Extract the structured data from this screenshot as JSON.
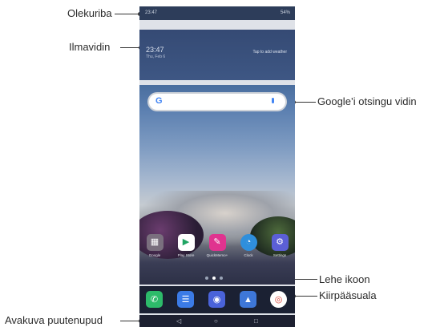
{
  "callouts": {
    "status_bar": "Olekuriba",
    "weather_widget": "Ilmavidin",
    "google_search": "Google’i otsingu vidin",
    "page_icon": "Lehe ikoon",
    "quick_access": "Kiirpääsuala",
    "home_touch_buttons": "Avakuva puutenupud"
  },
  "status_bar": {
    "time": "23:47",
    "battery": "54%"
  },
  "weather": {
    "clock": "23:47",
    "date": "Thu, Feb 6",
    "hint": "Tap to add weather"
  },
  "google": {
    "logo": "G"
  },
  "apps": [
    {
      "name": "Google",
      "icon": "google-folder-icon",
      "color": "#7a6f7e"
    },
    {
      "name": "Play Store",
      "icon": "play-store-icon",
      "color": "#ffffff"
    },
    {
      "name": "QuickMemo+",
      "icon": "quickmemo-icon",
      "color": "#e0338f"
    },
    {
      "name": "Clock",
      "icon": "clock-icon",
      "color": "#2f8fdc"
    },
    {
      "name": "Settings",
      "icon": "settings-icon",
      "color": "#5b5fd6"
    }
  ],
  "dock": [
    {
      "icon": "phone-icon",
      "color": "#2dbb6a"
    },
    {
      "icon": "messages-icon",
      "color": "#3b7be6"
    },
    {
      "icon": "camera-icon",
      "color": "#4a63d9"
    },
    {
      "icon": "gallery-icon",
      "color": "#3e77d8"
    },
    {
      "icon": "chrome-icon",
      "color": "#ffffff"
    }
  ],
  "navbar": {
    "back": "◁",
    "home": "○",
    "recents": "□"
  }
}
